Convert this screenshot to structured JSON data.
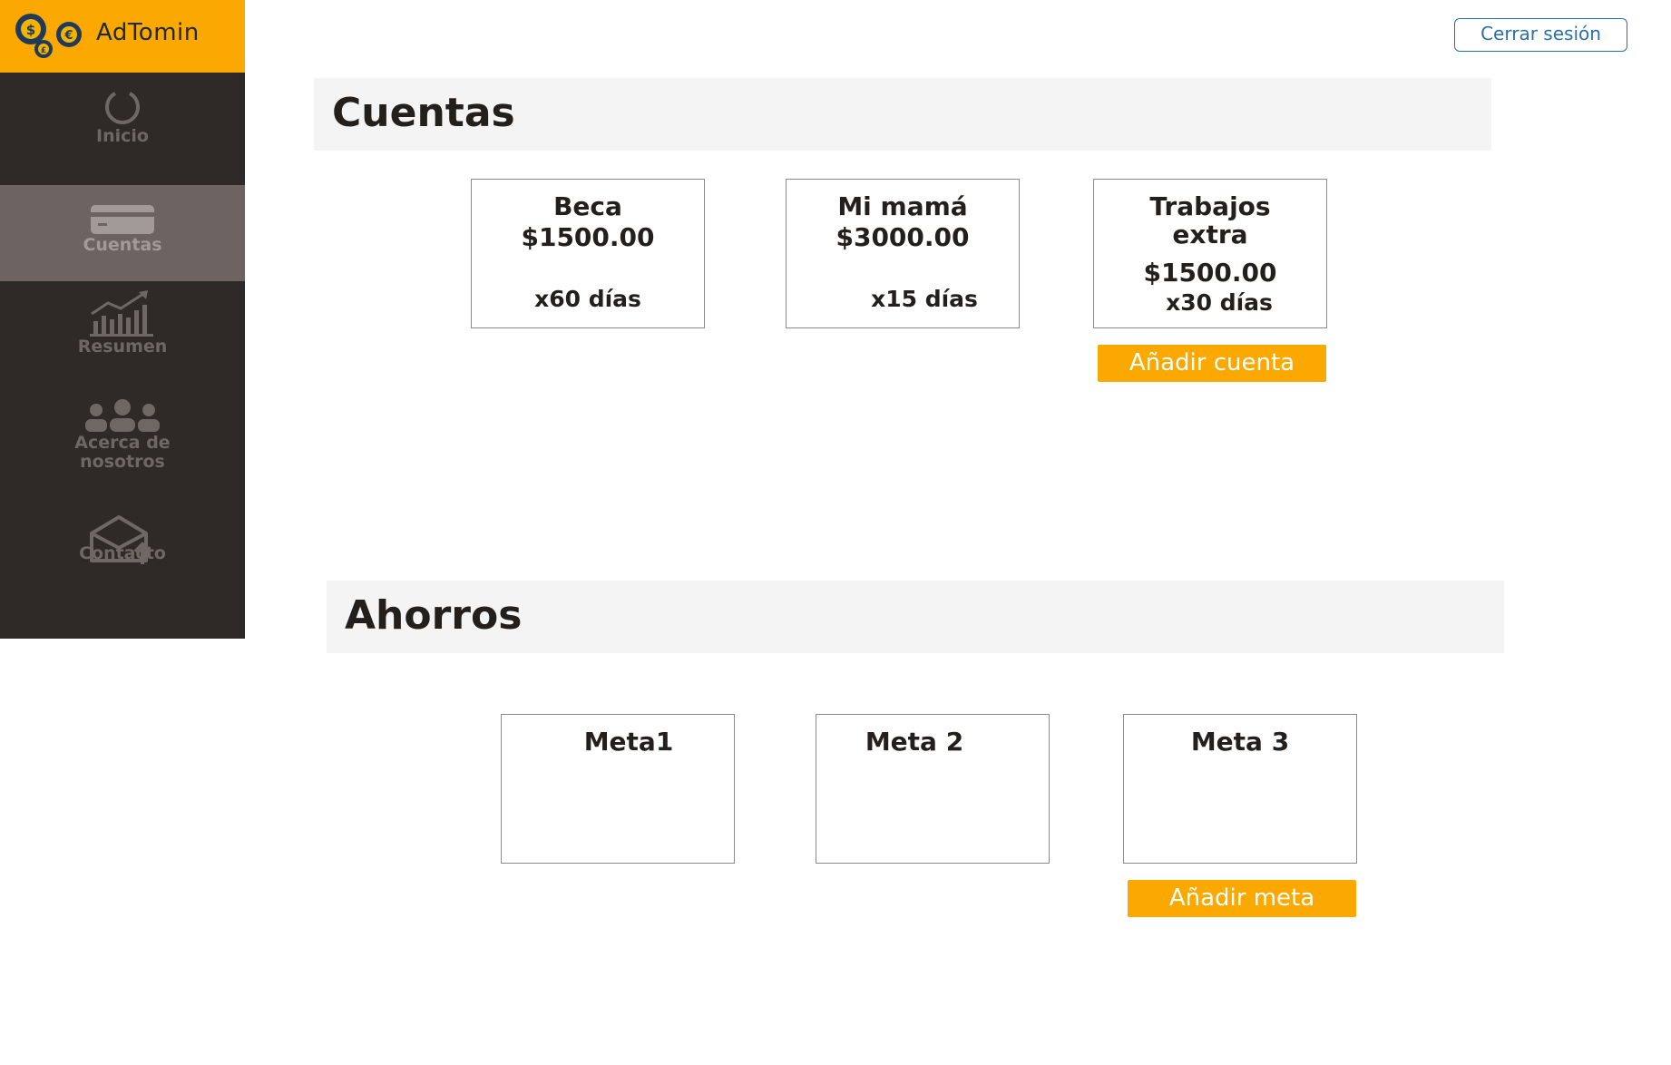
{
  "brand": {
    "name": "AdTomin",
    "color": "#fba800"
  },
  "sidebar": {
    "items": [
      {
        "label": "Inicio",
        "icon": "loading-circle-icon",
        "active": false
      },
      {
        "label": "Cuentas",
        "icon": "credit-card-icon",
        "active": true
      },
      {
        "label": "Resumen",
        "icon": "chart-growth-icon",
        "active": false
      },
      {
        "label": "Acerca de nosotros",
        "icon": "group-icon",
        "active": false
      },
      {
        "label": "Contacto",
        "icon": "envelope-upload-icon",
        "active": false
      }
    ]
  },
  "header": {
    "logout_label": "Cerrar sesión"
  },
  "accounts": {
    "title": "Cuentas",
    "cards": [
      {
        "name": "Beca",
        "amount": "$1500.00",
        "period": "x60 días"
      },
      {
        "name": "Mi mamá",
        "amount": "$3000.00",
        "period": "x15 días"
      },
      {
        "name_line1": "Trabajos",
        "name_line2": "extra",
        "amount": "$1500.00",
        "period": "x30 días"
      }
    ],
    "add_label": "Añadir cuenta"
  },
  "savings": {
    "title": "Ahorros",
    "cards": [
      {
        "name": "Meta1"
      },
      {
        "name": "Meta 2"
      },
      {
        "name": "Meta 3"
      }
    ],
    "add_label": "Añadir meta"
  }
}
